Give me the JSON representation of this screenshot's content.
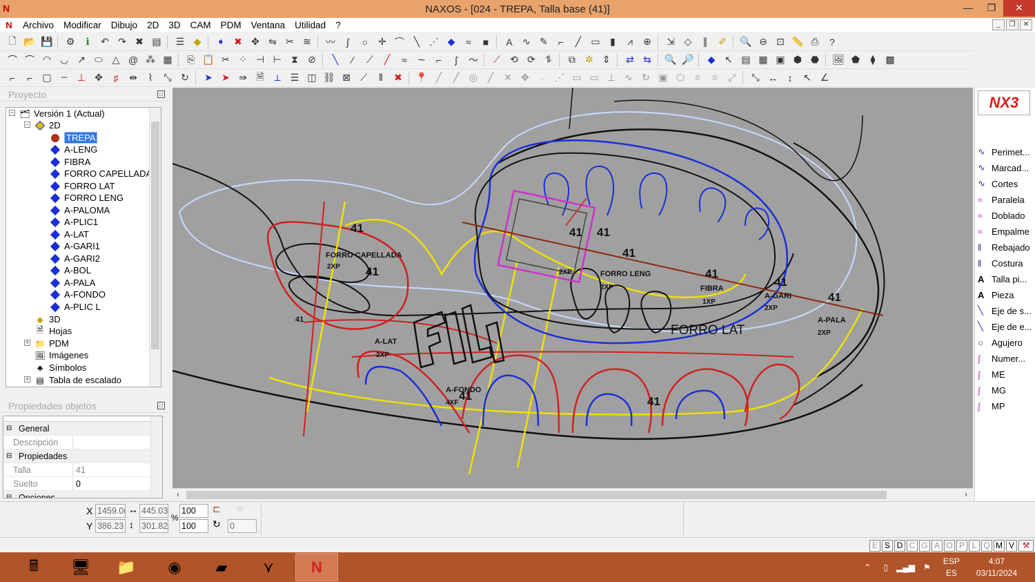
{
  "window": {
    "title": "NAXOS - [024 - TREPA, Talla base (41)]",
    "buttons": [
      "—",
      "❐",
      "✕"
    ]
  },
  "menu": [
    "Archivo",
    "Modificar",
    "Dibujo",
    "2D",
    "3D",
    "CAM",
    "PDM",
    "Ventana",
    "Utilidad",
    "?"
  ],
  "project_panel": {
    "title": "Proyecto",
    "tree": [
      {
        "label": "Versión 1 (Actual)",
        "level": 0,
        "icon": "version-icon",
        "expanded": true
      },
      {
        "label": "2D",
        "level": 1,
        "icon": "layer-2d-icon",
        "expanded": true
      },
      {
        "label": "TREPA",
        "level": 2,
        "icon": "piece-active-icon",
        "selected": true
      },
      {
        "label": "A-LENG",
        "level": 2,
        "icon": "piece-icon"
      },
      {
        "label": "FIBRA",
        "level": 2,
        "icon": "piece-icon"
      },
      {
        "label": "FORRO CAPELLADA",
        "level": 2,
        "icon": "piece-icon"
      },
      {
        "label": "FORRO LAT",
        "level": 2,
        "icon": "piece-icon"
      },
      {
        "label": "FORRO LENG",
        "level": 2,
        "icon": "piece-icon"
      },
      {
        "label": "A-PALOMA",
        "level": 2,
        "icon": "piece-icon"
      },
      {
        "label": "A-PLIC1",
        "level": 2,
        "icon": "piece-icon"
      },
      {
        "label": "A-LAT",
        "level": 2,
        "icon": "piece-icon"
      },
      {
        "label": "A-GARI1",
        "level": 2,
        "icon": "piece-icon"
      },
      {
        "label": "A-GARI2",
        "level": 2,
        "icon": "piece-icon"
      },
      {
        "label": "A-BOL",
        "level": 2,
        "icon": "piece-icon"
      },
      {
        "label": "A-PALA",
        "level": 2,
        "icon": "piece-icon"
      },
      {
        "label": "A-FONDO",
        "level": 2,
        "icon": "piece-icon"
      },
      {
        "label": "A-PLIC L",
        "level": 2,
        "icon": "piece-icon"
      },
      {
        "label": "3D",
        "level": 1,
        "icon": "layer-3d-icon"
      },
      {
        "label": "Hojas",
        "level": 1,
        "icon": "sheets-icon"
      },
      {
        "label": "PDM",
        "level": 1,
        "icon": "folder-icon",
        "collapsed": true
      },
      {
        "label": "Imágenes",
        "level": 1,
        "icon": "images-icon"
      },
      {
        "label": "Símbolos",
        "level": 1,
        "icon": "symbols-icon"
      },
      {
        "label": "Tabla de escalado",
        "level": 1,
        "icon": "grading-table-icon",
        "collapsed": true
      }
    ]
  },
  "props_panel": {
    "title": "Propiedades objetos",
    "groups": [
      {
        "name": "General",
        "rows": [
          {
            "key": "Descripción",
            "value": ""
          }
        ]
      },
      {
        "name": "Propiedades",
        "rows": [
          {
            "key": "Talla",
            "value": "41"
          },
          {
            "key": "Suelto",
            "value": "0"
          }
        ]
      },
      {
        "name": "Opciones",
        "rows": []
      }
    ]
  },
  "right_panel": {
    "logo": "NX3",
    "tools": [
      "Perimet...",
      "Marcad...",
      "Cortes",
      "Paralela",
      "Doblado",
      "Empalme",
      "Rebajado",
      "Costura",
      "Talla pi...",
      "Pieza",
      "Eje de s...",
      "Eje de e...",
      "Agujero",
      "Numer...",
      "ME",
      "MG",
      "MP"
    ]
  },
  "canvas_labels": {
    "size": "41",
    "forro_capellada": "FORRO CAPELLADA",
    "forro_leng": "FORRO LENG",
    "fibra": "FIBRA",
    "forro_lat": "FORRO LAT",
    "a_lat": "A-LAT",
    "a_fondo": "A-FONDO",
    "a_pala": "A-PALA",
    "a_gari": "A-GARI",
    "two_p": "2XP",
    "one_p": "1XP",
    "four_p": "4XF",
    "logo_text": "FILA"
  },
  "coords": {
    "x": "1459.0(",
    "dx": "445.03",
    "y": "386.23",
    "dy": "301.82",
    "scale_x": "100",
    "scale_y": "100",
    "rotation": "0",
    "percent": "%"
  },
  "status_flags": [
    "E",
    "S",
    "D",
    "C",
    "G",
    "A",
    "O",
    "P",
    "L",
    "Q",
    "M",
    "V"
  ],
  "taskbar": {
    "lang_top": "ESP",
    "lang_bottom": "ES",
    "time": "4:07",
    "date": "03/11/2024"
  },
  "colors": {
    "titlebar": "#e8a36c",
    "canvas": "#a0a0a0",
    "taskbar": "#b0542a",
    "selection": "#3377dd"
  }
}
